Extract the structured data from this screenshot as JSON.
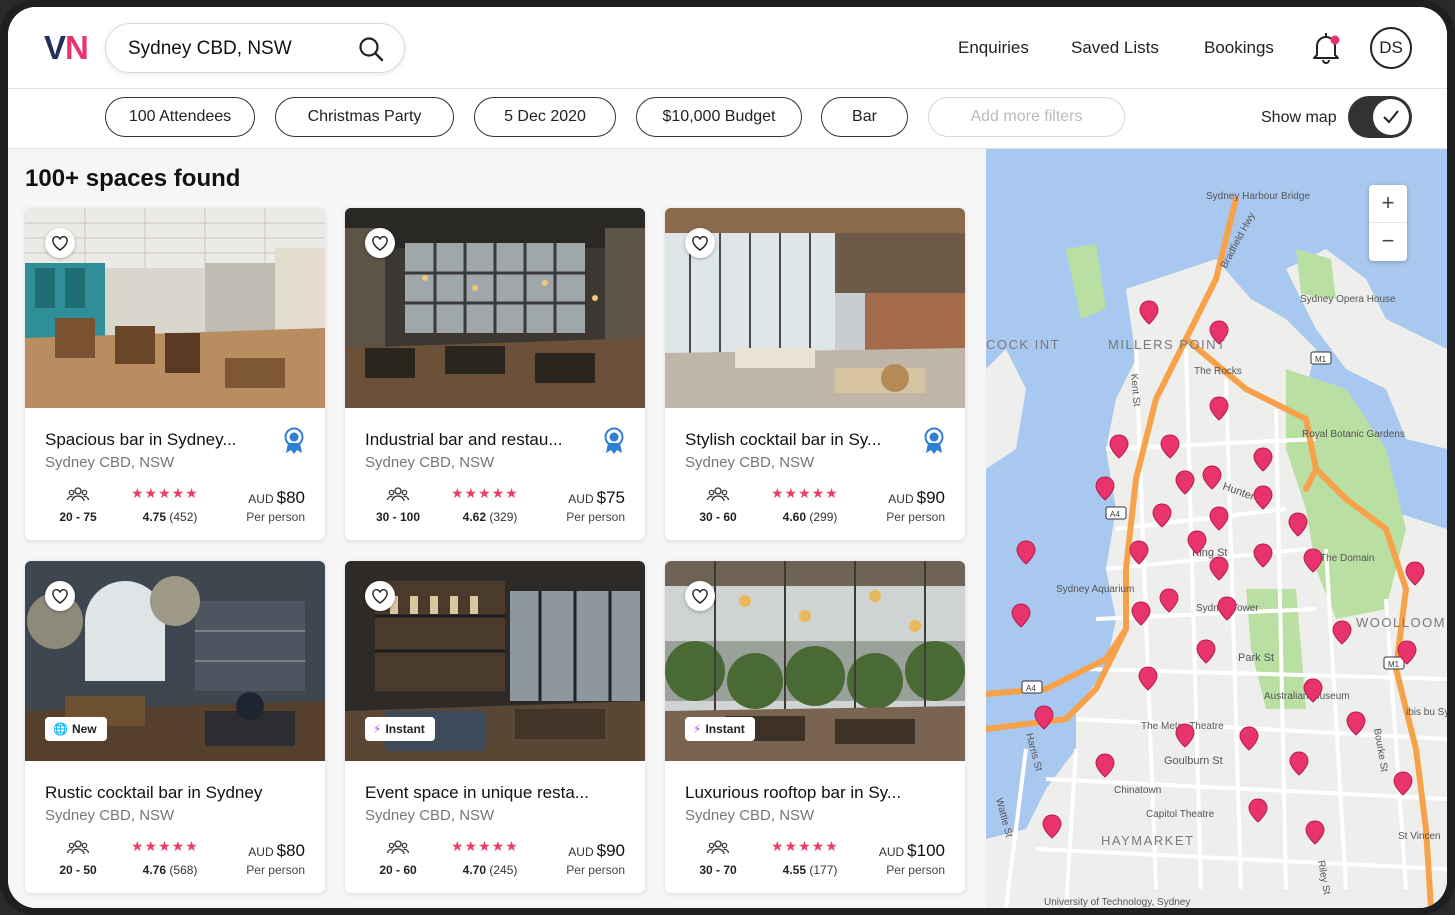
{
  "header": {
    "logo_v": "V",
    "logo_n": "N",
    "search_value": "Sydney CBD, NSW",
    "nav": [
      "Enquiries",
      "Saved Lists",
      "Bookings"
    ],
    "avatar_initials": "DS"
  },
  "filters": {
    "chips": [
      "100 Attendees",
      "Christmas Party",
      "5 Dec 2020",
      "$10,000 Budget",
      "Bar"
    ],
    "add_placeholder": "Add more filters",
    "show_map_label": "Show map",
    "show_map_on": true
  },
  "results": {
    "title": "100+ spaces found",
    "cards": [
      {
        "title": "Spacious bar in Sydney...",
        "location": "Sydney CBD, NSW",
        "capacity": "20 - 75",
        "rating": "4.75",
        "reviews": "(452)",
        "currency": "AUD",
        "price": "$80",
        "per": "Per person",
        "tag": "",
        "award": true
      },
      {
        "title": "Industrial bar and restau...",
        "location": "Sydney CBD, NSW",
        "capacity": "30 - 100",
        "rating": "4.62",
        "reviews": "(329)",
        "currency": "AUD",
        "price": "$75",
        "per": "Per person",
        "tag": "",
        "award": true
      },
      {
        "title": "Stylish cocktail bar in Sy...",
        "location": "Sydney CBD, NSW",
        "capacity": "30 - 60",
        "rating": "4.60",
        "reviews": "(299)",
        "currency": "AUD",
        "price": "$90",
        "per": "Per person",
        "tag": "",
        "award": true
      },
      {
        "title": "Rustic cocktail bar in Sydney",
        "location": "Sydney CBD, NSW",
        "capacity": "20 - 50",
        "rating": "4.76",
        "reviews": "(568)",
        "currency": "AUD",
        "price": "$80",
        "per": "Per person",
        "tag": "New",
        "award": false
      },
      {
        "title": "Event space in unique resta...",
        "location": "Sydney CBD, NSW",
        "capacity": "20 - 60",
        "rating": "4.70",
        "reviews": "(245)",
        "currency": "AUD",
        "price": "$90",
        "per": "Per person",
        "tag": "Instant",
        "award": false
      },
      {
        "title": "Luxurious rooftop bar in Sy...",
        "location": "Sydney CBD, NSW",
        "capacity": "30 - 70",
        "rating": "4.55",
        "reviews": "(177)",
        "currency": "AUD",
        "price": "$100",
        "per": "Per person",
        "tag": "Instant",
        "award": false
      }
    ]
  },
  "map": {
    "zoom_in": "+",
    "zoom_out": "−",
    "labels": {
      "harbour_bridge": "Sydney Harbour Bridge",
      "opera_house": "Sydney Opera House",
      "millers_point": "MILLERS POINT",
      "cockle_bay": "COCK INT",
      "rocks": "The Rocks",
      "kent_st": "Kent St",
      "bradfield": "Bradfield Hwy",
      "botanic": "Royal Botanic Gardens",
      "hunter": "Hunter",
      "king_st": "King St",
      "domain": "The Domain",
      "aquarium": "Sydney Aquarium",
      "tower": "Sydney Tower",
      "woolloomooloo": "WOOLLOOM",
      "park_st": "Park St",
      "museum": "Australian Museum",
      "theatre": "The Metro Theatre",
      "goulburn": "Goulburn St",
      "chinatown": "Chinatown",
      "capitol": "Capitol Theatre",
      "haymarket": "HAYMARKET",
      "uni": "University of Technology, Sydney",
      "harris": "Harris St",
      "wattle": "Wattle St",
      "bourke": "Bourke St",
      "riley": "Riley St",
      "stvincent": "St Vincen",
      "ibis": "ibis bu Sydney",
      "m1": "M1",
      "a4": "A4"
    }
  },
  "colors": {
    "brand_navy": "#22305f",
    "brand_pink": "#e8336d",
    "star": "#ec3c67",
    "award_blue": "#2f7fd6",
    "map_water": "#a9c8ef",
    "map_park": "#b9dfa3",
    "map_motorway": "#f7a24b",
    "pin": "#e8336d"
  }
}
